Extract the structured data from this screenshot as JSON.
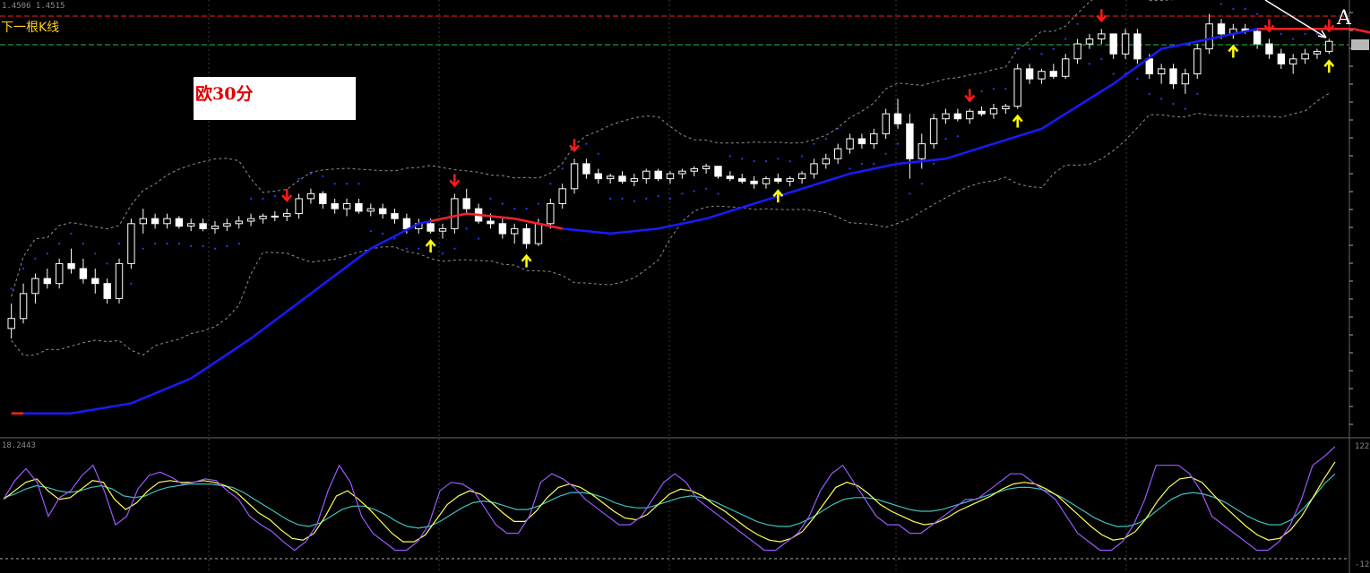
{
  "header": {
    "price_readout": "1.4506 1.4515",
    "next_bar_label": "下一根K线",
    "note_label": "欧30分",
    "marker_letter": "A"
  },
  "indicator": {
    "value_readout": "18.2443",
    "right_top_value": "122",
    "right_bottom_value": "-12"
  },
  "colors": {
    "background": "#000000",
    "bull_candle": "#ffffff",
    "bear_candle": "#ffffff",
    "ma_up": "#1a1aff",
    "ma_down": "#ff2020",
    "sell_arrow": "#ff1a1a",
    "buy_arrow": "#ffff00",
    "stoch_main": "#9b59ff",
    "stoch_signal": "#ffff55",
    "stoch_slow": "#40c0c0",
    "band": "#909090",
    "band_dots": "#2040ff",
    "red_level": "#ff2020",
    "green_level": "#20c040"
  },
  "chart_data": {
    "type": "candlestick",
    "timeframe_note": "欧30分",
    "ylim": [
      0,
      100
    ],
    "candles": [
      {
        "o": 12,
        "h": 22,
        "l": 8,
        "c": 16
      },
      {
        "o": 16,
        "h": 30,
        "l": 14,
        "c": 26
      },
      {
        "o": 26,
        "h": 34,
        "l": 22,
        "c": 32
      },
      {
        "o": 32,
        "h": 36,
        "l": 28,
        "c": 30
      },
      {
        "o": 30,
        "h": 40,
        "l": 28,
        "c": 38
      },
      {
        "o": 38,
        "h": 44,
        "l": 34,
        "c": 36
      },
      {
        "o": 36,
        "h": 40,
        "l": 30,
        "c": 32
      },
      {
        "o": 32,
        "h": 36,
        "l": 26,
        "c": 30
      },
      {
        "o": 30,
        "h": 32,
        "l": 22,
        "c": 24
      },
      {
        "o": 24,
        "h": 40,
        "l": 22,
        "c": 38
      },
      {
        "o": 38,
        "h": 56,
        "l": 36,
        "c": 54
      },
      {
        "o": 54,
        "h": 60,
        "l": 50,
        "c": 56
      },
      {
        "o": 56,
        "h": 58,
        "l": 52,
        "c": 54
      },
      {
        "o": 54,
        "h": 58,
        "l": 52,
        "c": 56
      },
      {
        "o": 56,
        "h": 57,
        "l": 52,
        "c": 53
      },
      {
        "o": 53,
        "h": 56,
        "l": 51,
        "c": 54
      },
      {
        "o": 54,
        "h": 56,
        "l": 51,
        "c": 52
      },
      {
        "o": 52,
        "h": 55,
        "l": 50,
        "c": 53
      },
      {
        "o": 53,
        "h": 56,
        "l": 51,
        "c": 54
      },
      {
        "o": 54,
        "h": 57,
        "l": 52,
        "c": 55
      },
      {
        "o": 55,
        "h": 58,
        "l": 53,
        "c": 56
      },
      {
        "o": 56,
        "h": 58,
        "l": 54,
        "c": 57
      },
      {
        "o": 57,
        "h": 59,
        "l": 55,
        "c": 57
      },
      {
        "o": 57,
        "h": 60,
        "l": 55,
        "c": 58
      },
      {
        "o": 58,
        "h": 66,
        "l": 56,
        "c": 64
      },
      {
        "o": 64,
        "h": 68,
        "l": 62,
        "c": 66
      },
      {
        "o": 66,
        "h": 67,
        "l": 60,
        "c": 62
      },
      {
        "o": 62,
        "h": 64,
        "l": 58,
        "c": 60
      },
      {
        "o": 60,
        "h": 64,
        "l": 57,
        "c": 62
      },
      {
        "o": 62,
        "h": 64,
        "l": 58,
        "c": 59
      },
      {
        "o": 59,
        "h": 62,
        "l": 57,
        "c": 60
      },
      {
        "o": 60,
        "h": 62,
        "l": 56,
        "c": 58
      },
      {
        "o": 58,
        "h": 60,
        "l": 54,
        "c": 56
      },
      {
        "o": 56,
        "h": 58,
        "l": 50,
        "c": 52
      },
      {
        "o": 52,
        "h": 56,
        "l": 50,
        "c": 54
      },
      {
        "o": 54,
        "h": 56,
        "l": 50,
        "c": 51
      },
      {
        "o": 51,
        "h": 54,
        "l": 48,
        "c": 52
      },
      {
        "o": 52,
        "h": 66,
        "l": 50,
        "c": 64
      },
      {
        "o": 64,
        "h": 68,
        "l": 58,
        "c": 60
      },
      {
        "o": 60,
        "h": 62,
        "l": 54,
        "c": 55
      },
      {
        "o": 55,
        "h": 58,
        "l": 52,
        "c": 54
      },
      {
        "o": 54,
        "h": 56,
        "l": 48,
        "c": 50
      },
      {
        "o": 50,
        "h": 54,
        "l": 46,
        "c": 52
      },
      {
        "o": 52,
        "h": 54,
        "l": 44,
        "c": 46
      },
      {
        "o": 46,
        "h": 56,
        "l": 45,
        "c": 54
      },
      {
        "o": 54,
        "h": 64,
        "l": 52,
        "c": 62
      },
      {
        "o": 62,
        "h": 70,
        "l": 60,
        "c": 68
      },
      {
        "o": 68,
        "h": 80,
        "l": 66,
        "c": 78
      },
      {
        "o": 78,
        "h": 80,
        "l": 72,
        "c": 74
      },
      {
        "o": 74,
        "h": 76,
        "l": 70,
        "c": 72
      },
      {
        "o": 72,
        "h": 74,
        "l": 70,
        "c": 73
      },
      {
        "o": 73,
        "h": 75,
        "l": 70,
        "c": 71
      },
      {
        "o": 71,
        "h": 74,
        "l": 69,
        "c": 72
      },
      {
        "o": 72,
        "h": 76,
        "l": 70,
        "c": 75
      },
      {
        "o": 75,
        "h": 76,
        "l": 71,
        "c": 72
      },
      {
        "o": 72,
        "h": 75,
        "l": 70,
        "c": 74
      },
      {
        "o": 74,
        "h": 76,
        "l": 72,
        "c": 75
      },
      {
        "o": 75,
        "h": 77,
        "l": 73,
        "c": 76
      },
      {
        "o": 76,
        "h": 78,
        "l": 74,
        "c": 77
      },
      {
        "o": 77,
        "h": 77,
        "l": 72,
        "c": 73
      },
      {
        "o": 73,
        "h": 75,
        "l": 71,
        "c": 72
      },
      {
        "o": 72,
        "h": 74,
        "l": 70,
        "c": 71
      },
      {
        "o": 71,
        "h": 73,
        "l": 68,
        "c": 70
      },
      {
        "o": 70,
        "h": 73,
        "l": 68,
        "c": 72
      },
      {
        "o": 72,
        "h": 74,
        "l": 70,
        "c": 71
      },
      {
        "o": 71,
        "h": 73,
        "l": 69,
        "c": 72
      },
      {
        "o": 72,
        "h": 75,
        "l": 70,
        "c": 74
      },
      {
        "o": 74,
        "h": 80,
        "l": 72,
        "c": 78
      },
      {
        "o": 78,
        "h": 82,
        "l": 76,
        "c": 80
      },
      {
        "o": 80,
        "h": 86,
        "l": 78,
        "c": 84
      },
      {
        "o": 84,
        "h": 90,
        "l": 82,
        "c": 88
      },
      {
        "o": 88,
        "h": 90,
        "l": 84,
        "c": 86
      },
      {
        "o": 86,
        "h": 92,
        "l": 84,
        "c": 90
      },
      {
        "o": 90,
        "h": 100,
        "l": 88,
        "c": 98
      },
      {
        "o": 98,
        "h": 104,
        "l": 92,
        "c": 94
      },
      {
        "o": 94,
        "h": 98,
        "l": 72,
        "c": 80
      },
      {
        "o": 80,
        "h": 90,
        "l": 76,
        "c": 86
      },
      {
        "o": 86,
        "h": 98,
        "l": 84,
        "c": 96
      },
      {
        "o": 96,
        "h": 100,
        "l": 94,
        "c": 98
      },
      {
        "o": 98,
        "h": 100,
        "l": 95,
        "c": 96
      },
      {
        "o": 96,
        "h": 100,
        "l": 94,
        "c": 99
      },
      {
        "o": 99,
        "h": 101,
        "l": 97,
        "c": 98
      },
      {
        "o": 98,
        "h": 102,
        "l": 96,
        "c": 100
      },
      {
        "o": 100,
        "h": 102,
        "l": 98,
        "c": 101
      },
      {
        "o": 101,
        "h": 118,
        "l": 100,
        "c": 116
      },
      {
        "o": 116,
        "h": 118,
        "l": 110,
        "c": 112
      },
      {
        "o": 112,
        "h": 116,
        "l": 110,
        "c": 115
      },
      {
        "o": 115,
        "h": 118,
        "l": 112,
        "c": 113
      },
      {
        "o": 113,
        "h": 122,
        "l": 112,
        "c": 120
      },
      {
        "o": 120,
        "h": 128,
        "l": 118,
        "c": 126
      },
      {
        "o": 126,
        "h": 130,
        "l": 124,
        "c": 128
      },
      {
        "o": 128,
        "h": 132,
        "l": 126,
        "c": 130
      },
      {
        "o": 130,
        "h": 130,
        "l": 120,
        "c": 122
      },
      {
        "o": 122,
        "h": 132,
        "l": 120,
        "c": 130
      },
      {
        "o": 130,
        "h": 132,
        "l": 118,
        "c": 120
      },
      {
        "o": 120,
        "h": 122,
        "l": 112,
        "c": 114
      },
      {
        "o": 114,
        "h": 118,
        "l": 110,
        "c": 116
      },
      {
        "o": 116,
        "h": 118,
        "l": 108,
        "c": 110
      },
      {
        "o": 110,
        "h": 116,
        "l": 106,
        "c": 114
      },
      {
        "o": 114,
        "h": 126,
        "l": 112,
        "c": 124
      },
      {
        "o": 124,
        "h": 138,
        "l": 122,
        "c": 134
      },
      {
        "o": 134,
        "h": 136,
        "l": 128,
        "c": 130
      },
      {
        "o": 130,
        "h": 134,
        "l": 128,
        "c": 132
      },
      {
        "o": 132,
        "h": 134,
        "l": 130,
        "c": 131
      },
      {
        "o": 131,
        "h": 132,
        "l": 124,
        "c": 126
      },
      {
        "o": 126,
        "h": 128,
        "l": 120,
        "c": 122
      },
      {
        "o": 122,
        "h": 124,
        "l": 116,
        "c": 118
      },
      {
        "o": 118,
        "h": 122,
        "l": 114,
        "c": 120
      },
      {
        "o": 120,
        "h": 124,
        "l": 118,
        "c": 122
      },
      {
        "o": 122,
        "h": 124,
        "l": 120,
        "c": 123
      },
      {
        "o": 123,
        "h": 128,
        "l": 122,
        "c": 127
      }
    ],
    "ma_line": [
      [
        0,
        -22
      ],
      [
        5,
        -22
      ],
      [
        10,
        -18
      ],
      [
        15,
        -8
      ],
      [
        20,
        8
      ],
      [
        25,
        26
      ],
      [
        30,
        44
      ],
      [
        34,
        54
      ],
      [
        38,
        58
      ],
      [
        42,
        56
      ],
      [
        46,
        52
      ],
      [
        50,
        50
      ],
      [
        54,
        52
      ],
      [
        58,
        56
      ],
      [
        62,
        62
      ],
      [
        66,
        68
      ],
      [
        70,
        74
      ],
      [
        74,
        78
      ],
      [
        78,
        80
      ],
      [
        82,
        86
      ],
      [
        86,
        92
      ],
      [
        88,
        98
      ],
      [
        92,
        110
      ],
      [
        96,
        124
      ],
      [
        100,
        128
      ],
      [
        104,
        132
      ],
      [
        108,
        132
      ],
      [
        112,
        132
      ],
      [
        116,
        128
      ],
      [
        120,
        126
      ],
      [
        124,
        128
      ]
    ],
    "ma_red_segments": [
      [
        0,
        1
      ],
      [
        35,
        46
      ],
      [
        104,
        118
      ]
    ],
    "sell_signal_indices": [
      23,
      37,
      47,
      80,
      91,
      105,
      123
    ],
    "buy_signal_indices": [
      35,
      43,
      64,
      84,
      102,
      118
    ],
    "stoch_main": [
      60,
      82,
      96,
      80,
      40,
      62,
      70,
      88,
      100,
      70,
      30,
      40,
      72,
      88,
      92,
      86,
      78,
      80,
      84,
      82,
      70,
      60,
      40,
      30,
      22,
      10,
      0,
      10,
      30,
      70,
      100,
      80,
      40,
      20,
      10,
      0,
      0,
      10,
      30,
      70,
      80,
      78,
      70,
      50,
      30,
      20,
      20,
      40,
      80,
      90,
      84,
      74,
      60,
      50,
      40,
      30,
      30,
      40,
      60,
      80,
      90,
      80,
      60,
      50,
      40,
      30,
      20,
      10,
      0,
      0,
      10,
      20,
      40,
      70,
      90,
      100,
      80,
      60,
      40,
      30,
      30,
      20,
      20,
      30,
      40,
      50,
      60,
      60,
      70,
      80,
      90,
      90,
      80,
      70,
      60,
      40,
      20,
      10,
      0,
      0,
      10,
      30,
      60,
      100,
      100,
      100,
      90,
      70,
      40,
      30,
      20,
      10,
      0,
      0,
      10,
      30,
      60,
      100,
      110,
      122
    ],
    "stoch_signal": [
      60,
      70,
      80,
      84,
      70,
      60,
      62,
      72,
      82,
      80,
      60,
      48,
      56,
      70,
      80,
      82,
      80,
      80,
      82,
      80,
      76,
      68,
      56,
      44,
      36,
      24,
      14,
      12,
      20,
      40,
      64,
      70,
      60,
      48,
      34,
      20,
      10,
      10,
      18,
      36,
      54,
      64,
      70,
      66,
      56,
      44,
      34,
      34,
      46,
      62,
      74,
      78,
      74,
      66,
      56,
      46,
      38,
      36,
      42,
      54,
      66,
      72,
      70,
      64,
      54,
      46,
      36,
      26,
      18,
      12,
      10,
      14,
      22,
      38,
      56,
      74,
      80,
      76,
      66,
      54,
      46,
      40,
      34,
      30,
      32,
      38,
      46,
      52,
      58,
      64,
      72,
      78,
      80,
      78,
      72,
      64,
      52,
      40,
      28,
      18,
      12,
      14,
      22,
      38,
      58,
      74,
      84,
      86,
      80,
      66,
      52,
      40,
      28,
      18,
      12,
      14,
      24,
      40,
      62,
      84,
      104
    ],
    "stoch_slow": [
      62,
      66,
      72,
      76,
      74,
      70,
      68,
      70,
      74,
      76,
      72,
      64,
      62,
      64,
      70,
      74,
      76,
      78,
      78,
      78,
      76,
      74,
      68,
      60,
      52,
      44,
      36,
      30,
      28,
      32,
      40,
      48,
      52,
      52,
      48,
      42,
      34,
      28,
      26,
      28,
      34,
      42,
      50,
      56,
      58,
      56,
      52,
      48,
      48,
      52,
      58,
      64,
      68,
      68,
      66,
      62,
      56,
      52,
      50,
      50,
      54,
      58,
      62,
      64,
      62,
      58,
      52,
      46,
      40,
      34,
      30,
      28,
      28,
      32,
      38,
      46,
      54,
      60,
      62,
      62,
      60,
      56,
      52,
      48,
      46,
      46,
      48,
      52,
      56,
      60,
      64,
      68,
      72,
      74,
      74,
      72,
      68,
      62,
      54,
      46,
      38,
      32,
      28,
      28,
      32,
      40,
      50,
      60,
      66,
      68,
      66,
      62,
      56,
      48,
      40,
      34,
      30,
      30,
      36,
      48,
      62,
      78,
      90
    ]
  }
}
